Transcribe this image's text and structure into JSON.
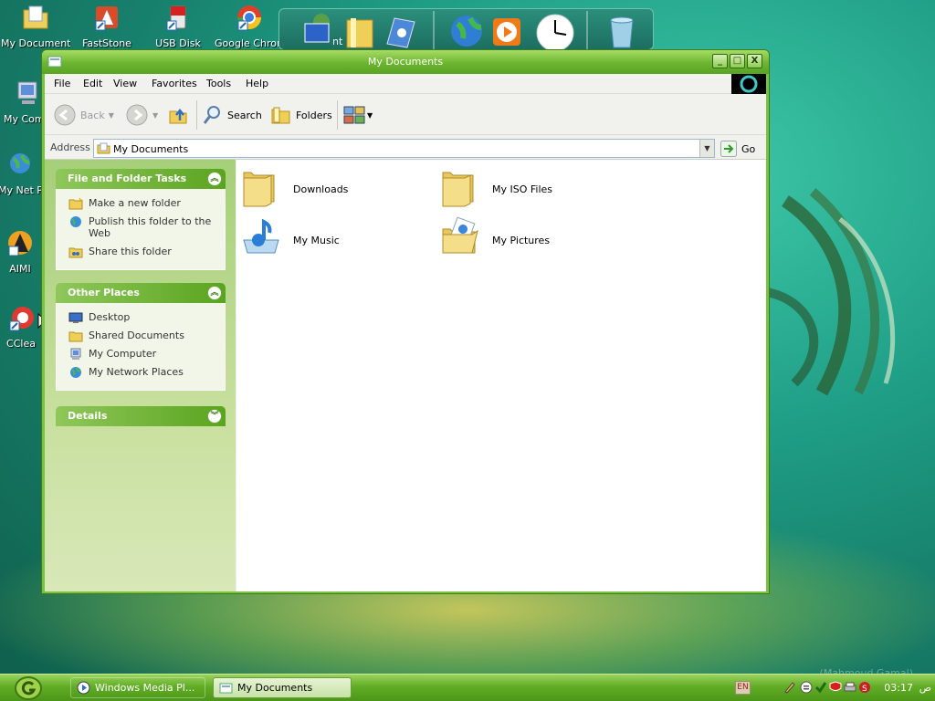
{
  "desktop": {
    "icons": [
      {
        "label": "My Documents"
      },
      {
        "label": "FastStone"
      },
      {
        "label": "USB Disk"
      },
      {
        "label": "Google Chrome"
      },
      {
        "label": "My Com"
      },
      {
        "label": "My Net Plac"
      },
      {
        "label": "AIMI"
      },
      {
        "label": "CClea"
      }
    ],
    "dock_partial_label": "nt",
    "watermark": "(Mahmoud Gamal)"
  },
  "window": {
    "title": "My Documents",
    "controls": {
      "minimize": "_",
      "maximize": "□",
      "close": "X"
    },
    "menu": [
      "File",
      "Edit",
      "View",
      "Favorites",
      "Tools",
      "Help"
    ],
    "toolbar": {
      "back": "Back",
      "search": "Search",
      "folders": "Folders"
    },
    "address": {
      "label": "Address",
      "value": "My Documents",
      "go": "Go"
    },
    "panels": {
      "tasks": {
        "title": "File and Folder Tasks",
        "items": [
          "Make a new folder",
          "Publish this folder to the Web",
          "Share this folder"
        ]
      },
      "places": {
        "title": "Other Places",
        "items": [
          "Desktop",
          "Shared Documents",
          "My Computer",
          "My Network Places"
        ]
      },
      "details": {
        "title": "Details"
      }
    },
    "items": [
      {
        "name": "Downloads",
        "icon": "folder-icon"
      },
      {
        "name": "My ISO Files",
        "icon": "folder-icon"
      },
      {
        "name": "My Music",
        "icon": "music-folder-icon"
      },
      {
        "name": "My Pictures",
        "icon": "pictures-folder-icon"
      }
    ]
  },
  "taskbar": {
    "buttons": [
      {
        "label": "Windows Media Pl...",
        "active": false
      },
      {
        "label": "My Documents",
        "active": true
      }
    ],
    "language": "EN",
    "time": "03:17",
    "ampm": "ص"
  },
  "colors": {
    "accent": "#6cb530",
    "taskbar": "#62ad26",
    "desktop": "#1f9e86"
  }
}
